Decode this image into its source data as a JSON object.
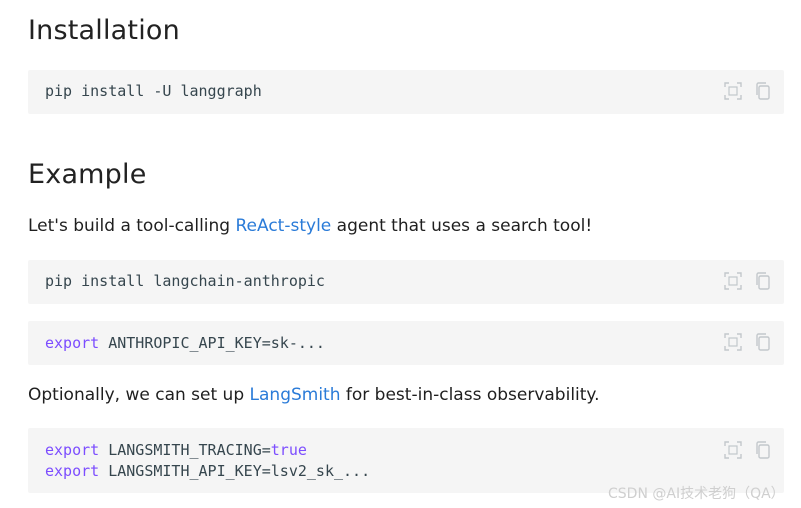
{
  "installation": {
    "heading": "Installation",
    "code": "pip install -U langgraph"
  },
  "example": {
    "heading": "Example",
    "intro": {
      "before": "Let's build a tool-calling ",
      "link": "ReAct-style",
      "after": " agent that uses a search tool!"
    },
    "code_install": "pip install langchain-anthropic",
    "code_env": {
      "keyword": "export",
      "var": " ANTHROPIC_API_KEY=",
      "value": "sk-..."
    },
    "optional": {
      "before": "Optionally, we can set up ",
      "link": "LangSmith",
      "after": " for best-in-class observability."
    },
    "code_langsmith": [
      {
        "keyword": "export",
        "var": " LANGSMITH_TRACING=",
        "value": "true"
      },
      {
        "keyword": "export",
        "var": " LANGSMITH_API_KEY=",
        "value": "lsv2_sk_..."
      }
    ]
  },
  "watermark": "CSDN @AI技术老狗（QA）",
  "icons": {
    "select": "select-all-icon",
    "copy": "copy-icon"
  },
  "colors": {
    "link": "#2a7bd8",
    "keyword": "#7c4dff",
    "code_bg": "#f5f5f5"
  }
}
